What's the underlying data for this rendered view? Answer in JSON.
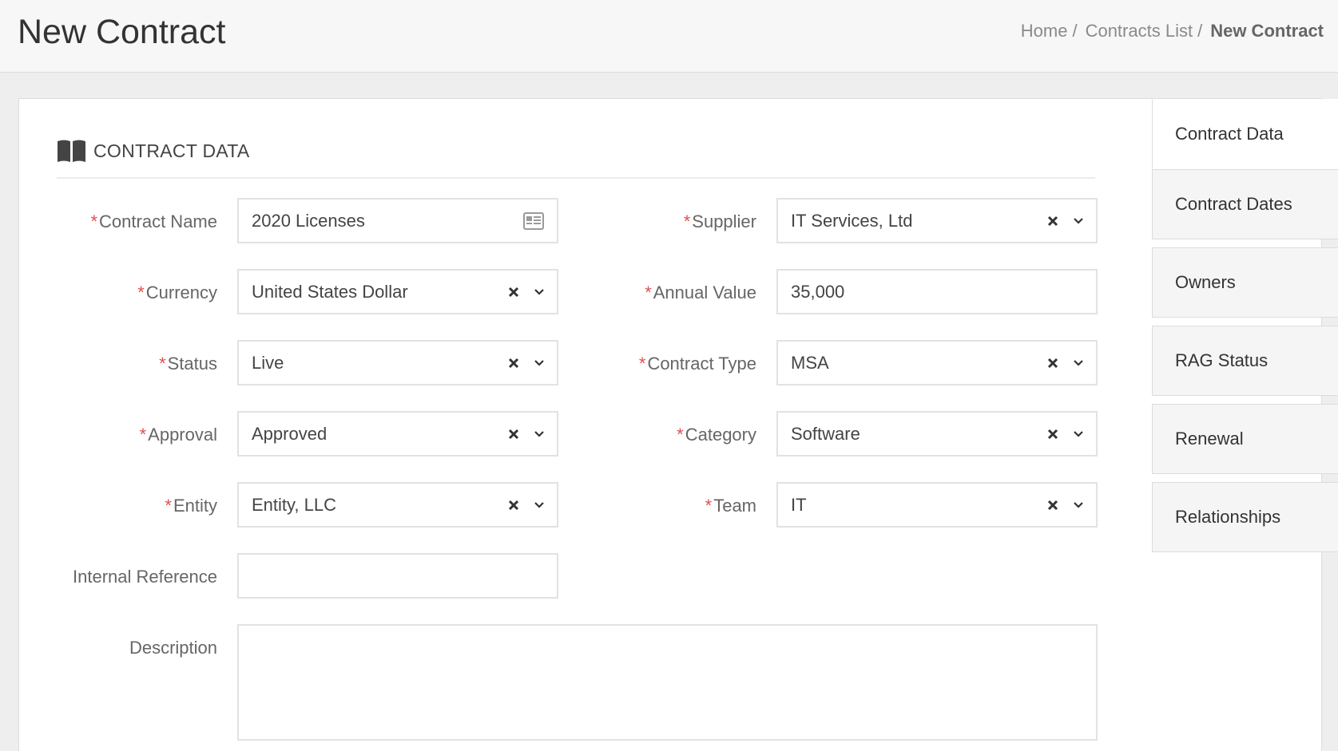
{
  "header": {
    "title": "New Contract",
    "breadcrumb": [
      {
        "label": "Home",
        "sep": "/"
      },
      {
        "label": "Contracts List",
        "sep": "/"
      },
      {
        "label": "New Contract",
        "sep": ""
      }
    ]
  },
  "section": {
    "icon": "book-icon",
    "title": "CONTRACT DATA"
  },
  "required_marker": "*",
  "fields": {
    "contract_name": {
      "label": "Contract Name",
      "value": "2020 Licenses",
      "icon": "contact-card-icon"
    },
    "supplier": {
      "label": "Supplier",
      "value": "IT Services, Ltd"
    },
    "currency": {
      "label": "Currency",
      "value": "United States Dollar"
    },
    "annual_value": {
      "label": "Annual Value",
      "value": "35,000"
    },
    "status": {
      "label": "Status",
      "value": "Live"
    },
    "contract_type": {
      "label": "Contract Type",
      "value": "MSA"
    },
    "approval": {
      "label": "Approval",
      "value": "Approved"
    },
    "category": {
      "label": "Category",
      "value": "Software"
    },
    "entity": {
      "label": "Entity",
      "value": "Entity, LLC"
    },
    "team": {
      "label": "Team",
      "value": "IT"
    },
    "internal_reference": {
      "label": "Internal Reference",
      "value": ""
    },
    "description": {
      "label": "Description",
      "value": ""
    }
  },
  "tabs": [
    {
      "label": "Contract Data",
      "active": true
    },
    {
      "label": "Contract Dates",
      "active": false
    },
    {
      "label": "Owners",
      "active": false
    },
    {
      "label": "RAG Status",
      "active": false
    },
    {
      "label": "Renewal",
      "active": false
    },
    {
      "label": "Relationships",
      "active": false
    }
  ],
  "colors": {
    "required": "#e05050",
    "border": "#e2e2e2",
    "tab_bg": "#f5f5f5"
  }
}
